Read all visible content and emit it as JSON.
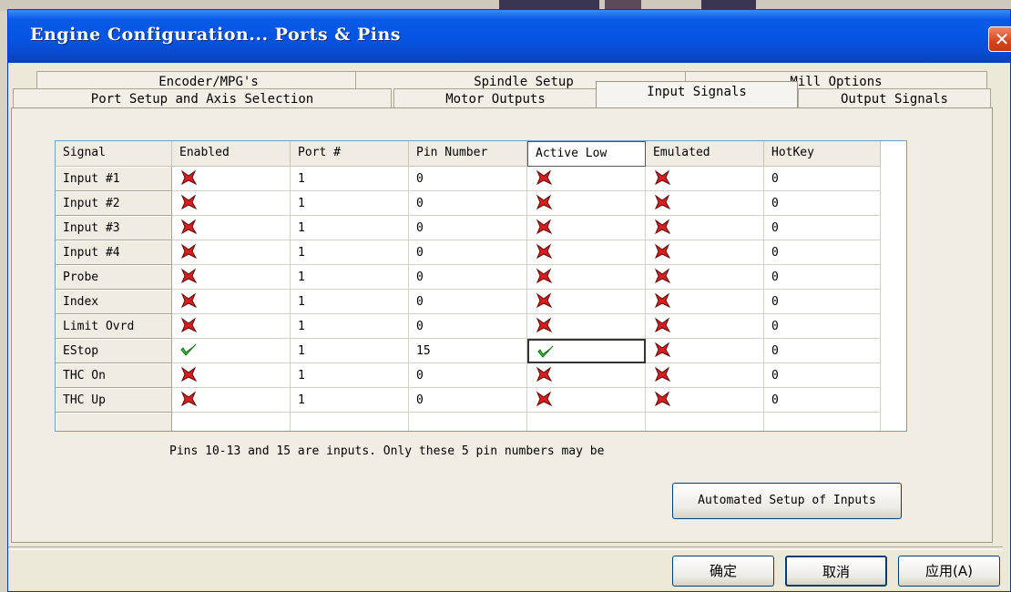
{
  "window": {
    "title": "Engine Configuration... Ports & Pins",
    "close_glyph": "✕"
  },
  "tabs_row1": [
    {
      "label": "Encoder/MPG's"
    },
    {
      "label": "Spindle Setup"
    },
    {
      "label": "Mill Options"
    }
  ],
  "tabs_row2": [
    {
      "label": "Port Setup and Axis Selection"
    },
    {
      "label": "Motor Outputs"
    },
    {
      "label": "Input Signals",
      "active": true
    },
    {
      "label": "Output Signals"
    }
  ],
  "grid": {
    "columns": [
      "Signal",
      "Enabled",
      "Port #",
      "Pin Number",
      "Active Low",
      "Emulated",
      "HotKey"
    ],
    "rows": [
      {
        "signal": "Input #1",
        "enabled": false,
        "port": "1",
        "pin": "0",
        "active_low": false,
        "emulated": false,
        "hotkey": "0"
      },
      {
        "signal": "Input #2",
        "enabled": false,
        "port": "1",
        "pin": "0",
        "active_low": false,
        "emulated": false,
        "hotkey": "0"
      },
      {
        "signal": "Input #3",
        "enabled": false,
        "port": "1",
        "pin": "0",
        "active_low": false,
        "emulated": false,
        "hotkey": "0"
      },
      {
        "signal": "Input #4",
        "enabled": false,
        "port": "1",
        "pin": "0",
        "active_low": false,
        "emulated": false,
        "hotkey": "0"
      },
      {
        "signal": "Probe",
        "enabled": false,
        "port": "1",
        "pin": "0",
        "active_low": false,
        "emulated": false,
        "hotkey": "0"
      },
      {
        "signal": "Index",
        "enabled": false,
        "port": "1",
        "pin": "0",
        "active_low": false,
        "emulated": false,
        "hotkey": "0"
      },
      {
        "signal": "Limit Ovrd",
        "enabled": false,
        "port": "1",
        "pin": "0",
        "active_low": false,
        "emulated": false,
        "hotkey": "0"
      },
      {
        "signal": "EStop",
        "enabled": true,
        "port": "1",
        "pin": "15",
        "active_low": true,
        "emulated": false,
        "hotkey": "0"
      },
      {
        "signal": "THC On",
        "enabled": false,
        "port": "1",
        "pin": "0",
        "active_low": false,
        "emulated": false,
        "hotkey": "0"
      },
      {
        "signal": "THC Up",
        "enabled": false,
        "port": "1",
        "pin": "0",
        "active_low": false,
        "emulated": false,
        "hotkey": "0"
      }
    ],
    "scroll_up_glyph": "▲",
    "scroll_down_glyph": "▼"
  },
  "note": "Pins 10-13 and 15 are inputs. Only these 5 pin numbers may be",
  "buttons": {
    "automated_setup": "Automated Setup of Inputs",
    "ok": "确定",
    "cancel": "取消",
    "apply": "应用(A)"
  },
  "icons": {
    "enabled_true": "green-check-icon",
    "enabled_false": "red-x-icon"
  },
  "colors": {
    "title_bar": "#0554e3",
    "check": "#3cc43c",
    "cross": "#d91e1e"
  }
}
